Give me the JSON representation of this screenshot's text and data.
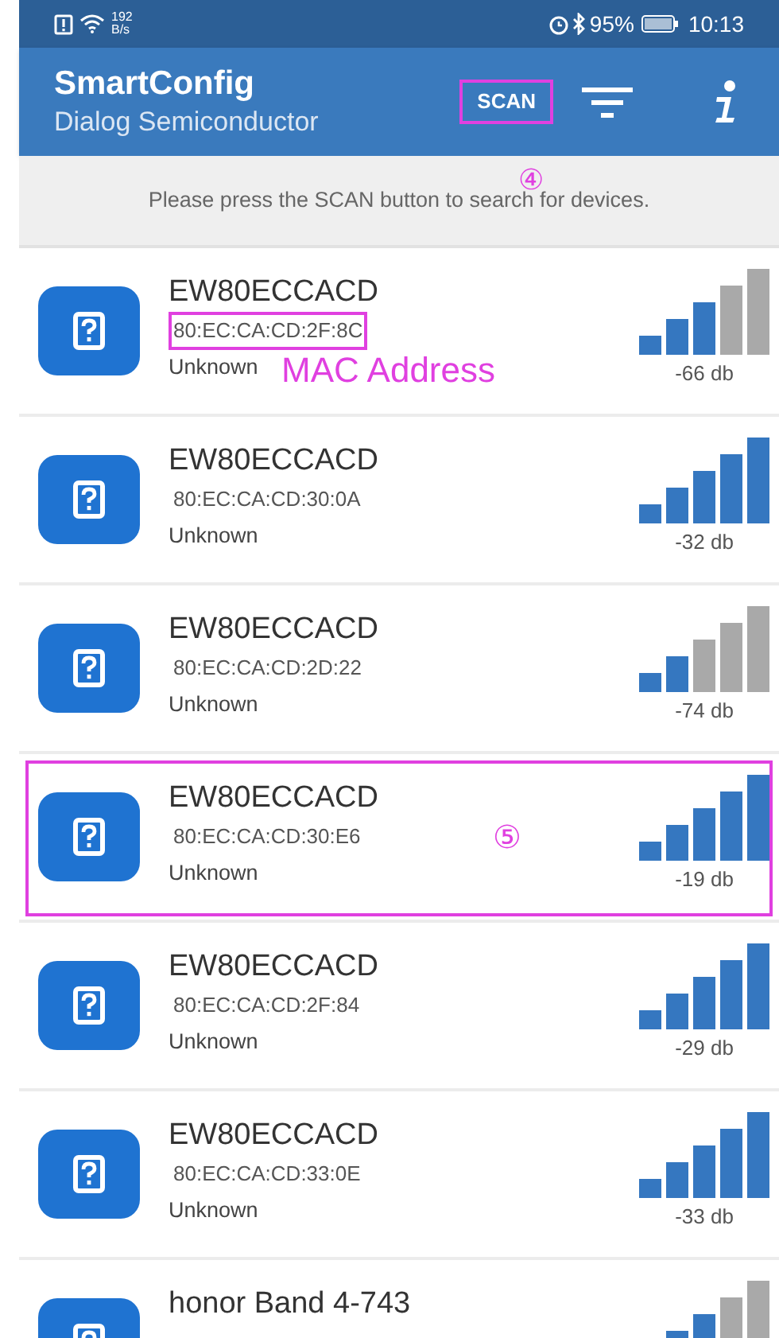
{
  "status_bar": {
    "speed_value": "192",
    "speed_unit": "B/s",
    "battery": "95%",
    "time": "10:13"
  },
  "app_bar": {
    "title": "SmartConfig",
    "subtitle": "Dialog Semiconductor",
    "scan_button": {
      "label": "SCAN",
      "highlighted": true
    }
  },
  "scan_marker": "④",
  "message": "Please press the SCAN button to search for devices.",
  "devices": [
    {
      "name": "EW80ECCACD",
      "mac": "80:EC:CA:CD:2F:8C",
      "type": "Unknown",
      "level": 0.6,
      "reading": "-66 db",
      "highlighted": false,
      "mac_highlighted": true,
      "annotation": "MAC Address"
    },
    {
      "name": "EW80ECCACD",
      "mac": "80:EC:CA:CD:30:0A",
      "type": "Unknown",
      "level": 1,
      "reading": "-32 db",
      "highlighted": false,
      "mac_highlighted": false
    },
    {
      "name": "EW80ECCACD",
      "mac": "80:EC:CA:CD:2D:22",
      "type": "Unknown",
      "level": 0.4,
      "reading": "-74 db",
      "highlighted": false,
      "mac_highlighted": false
    },
    {
      "name": "EW80ECCACD",
      "mac": "80:EC:CA:CD:30:E6",
      "type": "Unknown",
      "level": 1,
      "reading": "-19 db",
      "highlighted": true,
      "mac_highlighted": false,
      "annotation": "⑤"
    },
    {
      "name": "EW80ECCACD",
      "mac": "80:EC:CA:CD:2F:84",
      "type": "Unknown",
      "level": 1,
      "reading": "-29 db",
      "highlighted": false,
      "mac_highlighted": false
    },
    {
      "name": "EW80ECCACD",
      "mac": "80:EC:CA:CD:33:0E",
      "type": "Unknown",
      "level": 1,
      "reading": "-33 db",
      "highlighted": false,
      "mac_highlighted": false
    },
    {
      "name": "honor Band 4-743",
      "level": 0.6,
      "highlighted": false
    }
  ]
}
